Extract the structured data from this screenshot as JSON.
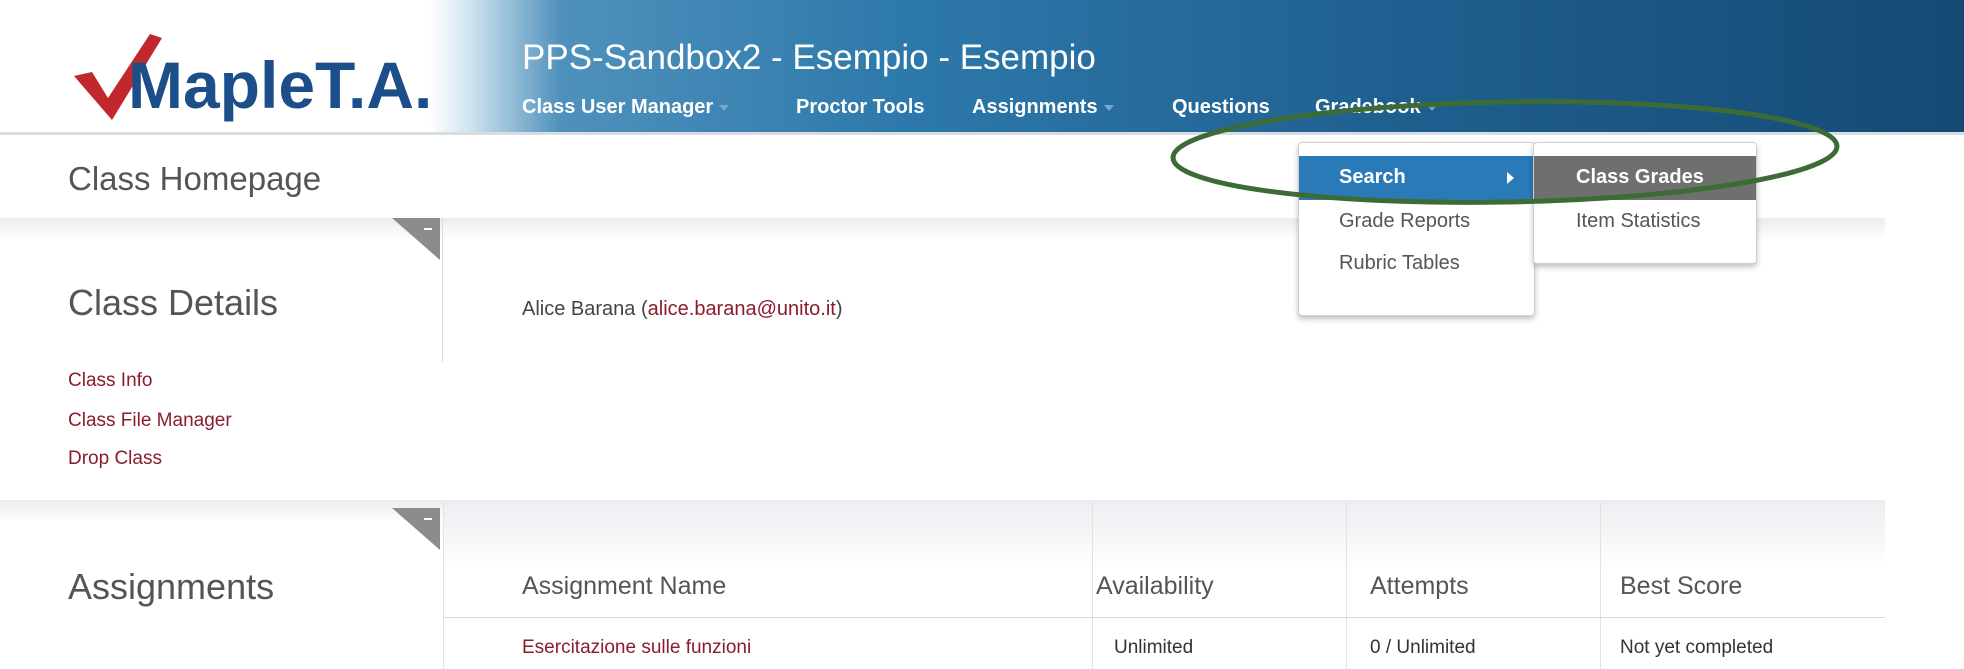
{
  "header": {
    "logo_text": "MapleT.A.",
    "app_title": "PPS-Sandbox2 - Esempio - Esempio",
    "nav": [
      {
        "label": "Class User Manager"
      },
      {
        "label": "Proctor Tools"
      },
      {
        "label": "Assignments"
      },
      {
        "label": "Questions"
      },
      {
        "label": "Gradebook"
      }
    ]
  },
  "page_title": "Class Homepage",
  "class_details": {
    "title": "Class Details",
    "links": [
      "Class Info",
      "Class File Manager",
      "Drop Class"
    ],
    "user_name": "Alice Barana",
    "user_email": "alice.barana@unito.it"
  },
  "assignments": {
    "title": "Assignments",
    "columns": [
      "Assignment Name",
      "Availability",
      "Attempts",
      "Best Score"
    ],
    "rows": [
      [
        "Esercitazione sulle funzioni",
        "Unlimited",
        "0 / Unlimited",
        "Not yet completed"
      ]
    ]
  },
  "gradebook_menu": {
    "items": [
      "Search",
      "Grade Reports",
      "Rubric Tables"
    ],
    "submenu": [
      "Class Grades",
      "Item Statistics"
    ]
  },
  "colors": {
    "accent_blue": "#2b7ab8",
    "link_red": "#8a1c2b",
    "annotation_green": "#3d6b36"
  }
}
